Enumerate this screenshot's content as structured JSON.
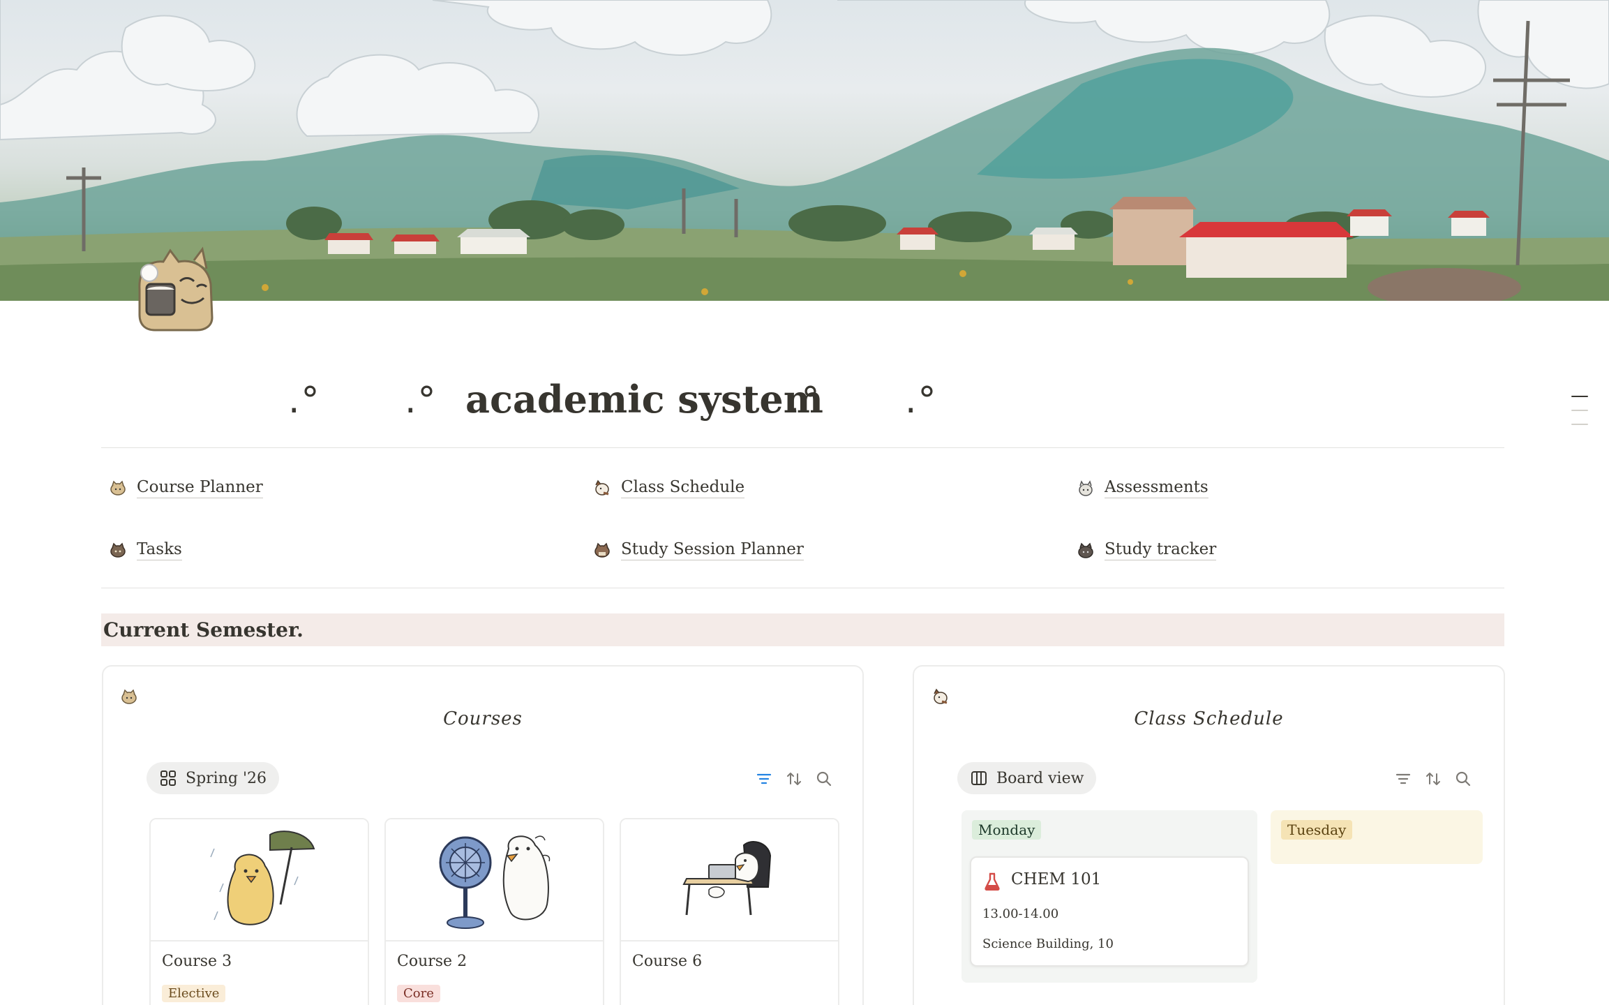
{
  "page": {
    "title": "academic system",
    "title_ornament": ".°"
  },
  "nav_links": [
    {
      "label": "Course Planner",
      "icon": "cat-emoji-icon"
    },
    {
      "label": "Class Schedule",
      "icon": "cat-emoji-icon"
    },
    {
      "label": "Assessments",
      "icon": "cat-emoji-icon"
    },
    {
      "label": "Tasks",
      "icon": "cat-emoji-icon"
    },
    {
      "label": "Study Session Planner",
      "icon": "cat-emoji-icon"
    },
    {
      "label": "Study tracker",
      "icon": "cat-emoji-icon"
    }
  ],
  "section": {
    "heading": "Current Semester."
  },
  "courses_panel": {
    "title": "Courses",
    "view_label": "Spring '26",
    "view_icon": "gallery-grid-icon",
    "tools": [
      "filter-icon",
      "sort-icon",
      "search-icon"
    ],
    "cards": [
      {
        "name": "Course 3",
        "tag": "Elective",
        "tag_style": "elective",
        "illustration": "duck-umbrella-illustration"
      },
      {
        "name": "Course 2",
        "tag": "Core",
        "tag_style": "core",
        "illustration": "duck-fan-illustration"
      },
      {
        "name": "Course 6",
        "tag": "",
        "tag_style": "",
        "illustration": "duck-desk-illustration"
      }
    ]
  },
  "schedule_panel": {
    "title": "Class Schedule",
    "view_label": "Board view",
    "view_icon": "board-columns-icon",
    "tools": [
      "filter-icon",
      "sort-icon",
      "search-icon"
    ],
    "columns": [
      {
        "label": "Monday",
        "cards": [
          {
            "title": "CHEM 101",
            "icon": "flask-icon",
            "time": "13.00-14.00",
            "location": "Science Building, 10"
          }
        ]
      },
      {
        "label": "Tuesday",
        "cards": []
      }
    ]
  },
  "colors": {
    "accent_blue": "#2383e2",
    "section_bg": "#f4ebe8",
    "monday_tag": "#dbeddb",
    "tuesday_tag": "#f5e3b5",
    "elective_tag": "#faedd8",
    "core_tag": "#f9dfdc"
  }
}
